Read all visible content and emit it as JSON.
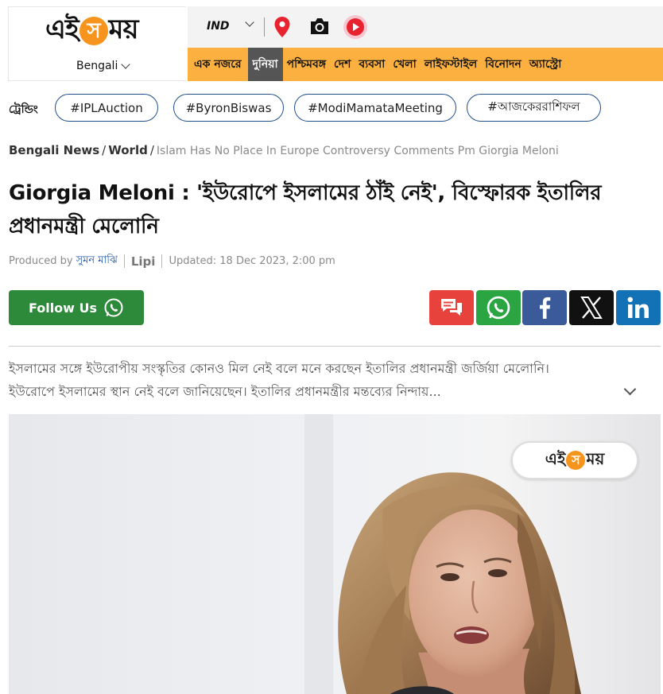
{
  "brand": {
    "logo_text_1": "এই",
    "logo_text_sun": "স",
    "logo_text_2": "ময়",
    "language": "Bengali"
  },
  "topbar": {
    "edition": "IND"
  },
  "nav": {
    "items": [
      {
        "label": "এক নজরে"
      },
      {
        "label": "দুনিয়া",
        "active": true
      },
      {
        "label": "পশ্চিমবঙ্গ"
      },
      {
        "label": "দেশ"
      },
      {
        "label": "ব্যবসা"
      },
      {
        "label": "খেলা"
      },
      {
        "label": "লাইফস্টাইল"
      },
      {
        "label": "বিনোদন"
      },
      {
        "label": "অ্যাস্ট্রো"
      }
    ]
  },
  "trending": {
    "label": "ট্রেন্ডিং",
    "tags": [
      "#IPLAuction",
      "#ByronBiswas",
      "#ModiMamataMeeting",
      "#আজকেররাশিফল"
    ]
  },
  "breadcrumb": {
    "home": "Bengali News",
    "section": "World",
    "current": "Islam Has No Place In Europe Controversy Comments Pm Giorgia Meloni"
  },
  "article": {
    "headline": "Giorgia Meloni : 'ইউরোপে ইসলামের ঠাঁই নেই', বিস্ফোরক ইতালির প্রধানমন্ত্রী মেলোনি",
    "produced_by_label": "Produced by",
    "author": "সুমন মাঝি",
    "source": "Lipi",
    "updated": "Updated: 18 Dec 2023, 2:00 pm",
    "summary": "ইসলামের সঙ্গে ইউরোপীয় সংস্কৃতির কোনও মিল নেই বলে মনে করছেন ইতালির প্রধানমন্ত্রী জর্জিয়া মেলোনি। ইউরোপে ইসলামের স্থান নেই বলে জানিয়েছেন। ইতালির প্রধানমন্ত্রীর মন্তব্যের নিন্দায়..."
  },
  "social": {
    "follow_label": "Follow Us",
    "share": [
      "comment-icon",
      "whatsapp-icon",
      "facebook-icon",
      "x-icon",
      "linkedin-icon"
    ]
  },
  "hero": {
    "watermark_1": "এই",
    "watermark_sun": "স",
    "watermark_2": "ময়"
  }
}
